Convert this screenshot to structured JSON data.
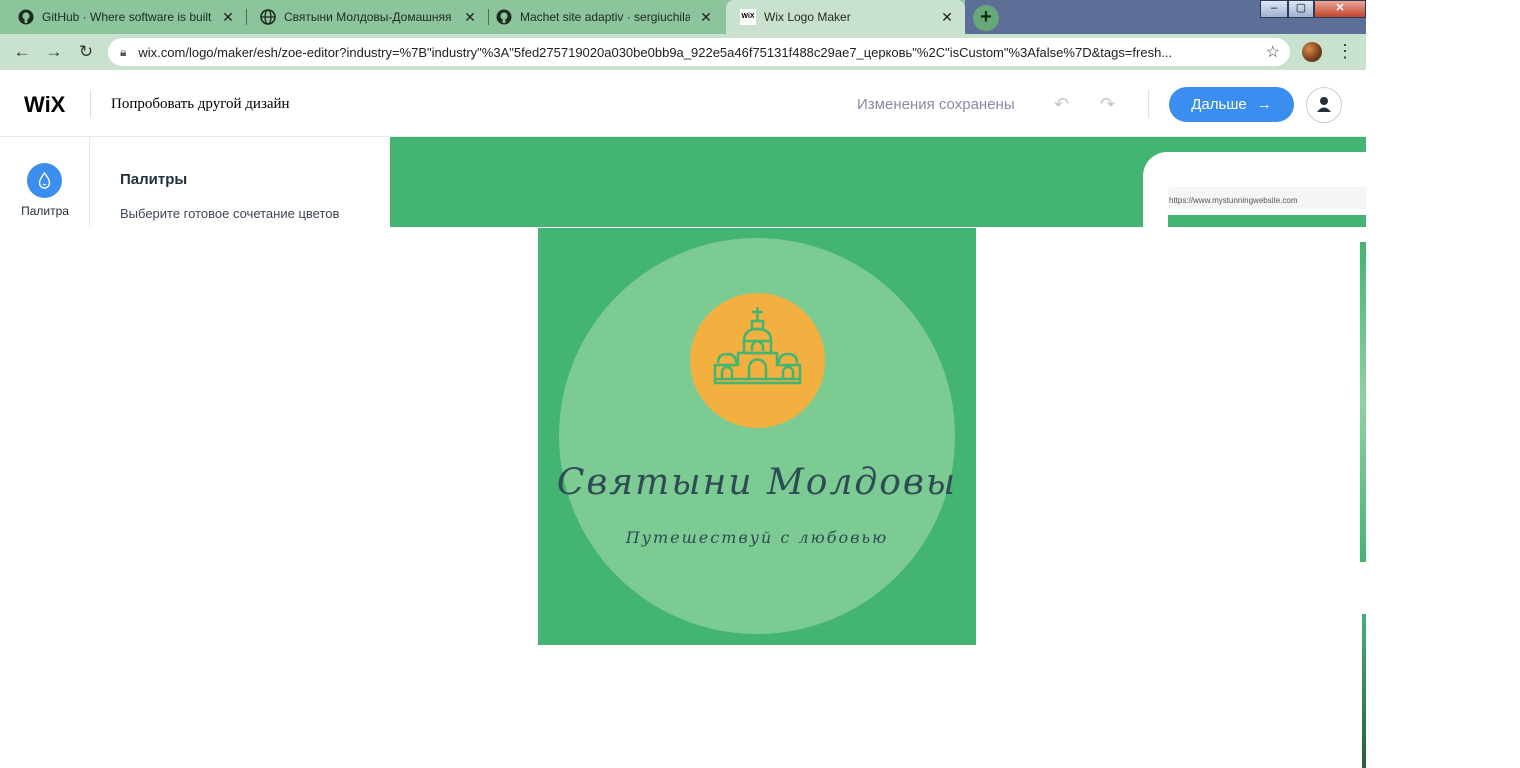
{
  "browser": {
    "tabs": [
      {
        "title": "GitHub · Where software is built",
        "icon": "github-icon"
      },
      {
        "title": "Святыни Молдовы-Домашняя с",
        "icon": "globe-icon"
      },
      {
        "title": "Machet site adaptiv · sergiuchila",
        "icon": "github-icon"
      },
      {
        "title": "Wix Logo Maker",
        "icon": "wix-favicon"
      }
    ],
    "new_tab": "+",
    "window_controls": {
      "minimize": "–",
      "maximize": "▢",
      "close": "✕"
    },
    "address_bar": {
      "url": "wix.com/logo/maker/esh/zoe-editor?industry=%7B\"industry\"%3A\"5fed275719020a030be0bb9a_922e5a46f75131f488c29ae7_церковь\"%2C\"isCustom\"%3Afalse%7D&tags=fresh..."
    },
    "colors": {
      "tabstrip": "#8cc49b",
      "toolbar": "#c9e2cf"
    }
  },
  "header": {
    "logo": "WiX",
    "try_other": "Попробовать другой дизайн",
    "status": "Изменения сохранены",
    "next_label": "Дальше",
    "accent": "#3b8ef0"
  },
  "sidebar": {
    "palette_label": "Палитра",
    "panel_title": "Палитры",
    "panel_desc": "Выберите готовое сочетание цветов"
  },
  "preview": {
    "mockup_url": "https://www.mystunningwebsite.com"
  },
  "logo": {
    "name": "Святыни Молдовы",
    "tagline": "Путешествуй с любовью",
    "icon": "church-icon",
    "colors": {
      "background": "#43b472",
      "glow": "#7ccb92",
      "emblem": "#f1b040",
      "text": "#2f4b55"
    }
  }
}
